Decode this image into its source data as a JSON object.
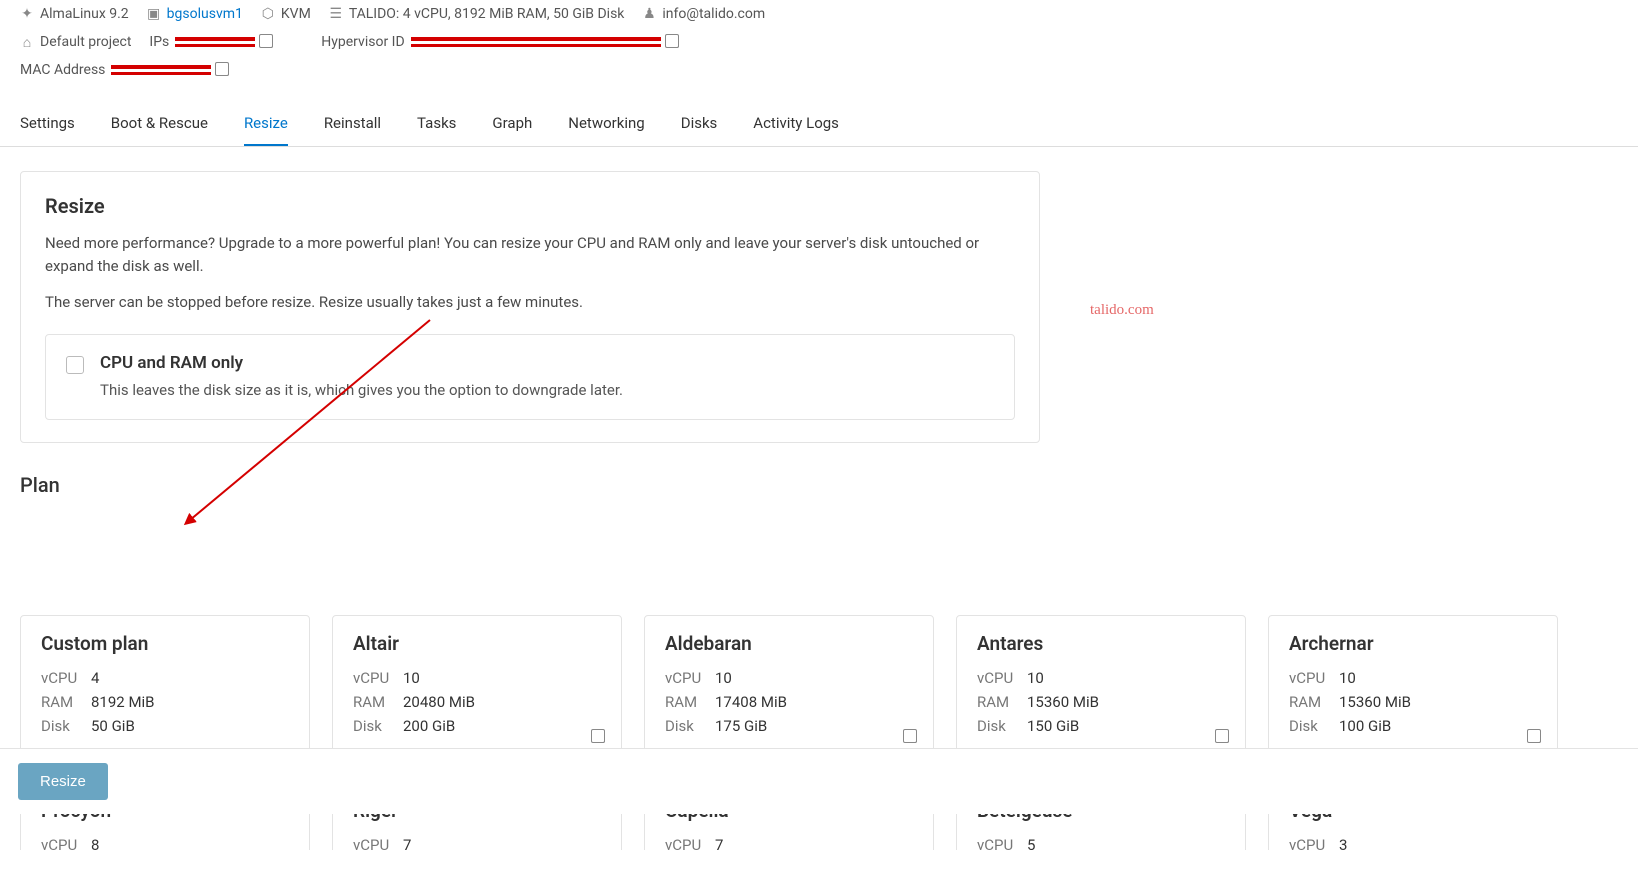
{
  "meta": {
    "os": "AlmaLinux 9.2",
    "hostname": "bgsolusvm1",
    "virt": "KVM",
    "specs": "TALIDO: 4 vCPU, 8192 MiB RAM, 50 GiB Disk",
    "email": "info@talido.com",
    "project": "Default project",
    "ips_label": "IPs",
    "hyp_label": "Hypervisor ID",
    "mac_label": "MAC Address"
  },
  "tabs": [
    "Settings",
    "Boot & Rescue",
    "Resize",
    "Reinstall",
    "Tasks",
    "Graph",
    "Networking",
    "Disks",
    "Activity Logs"
  ],
  "active_tab": "Resize",
  "resize": {
    "title": "Resize",
    "desc": "Need more performance? Upgrade to a more powerful plan! You can resize your CPU and RAM only and leave your server's disk untouched or expand the disk as well.",
    "warn": "The server can be stopped before resize. Resize usually takes just a few minutes.",
    "cpu_ram_only_title": "CPU and RAM only",
    "cpu_ram_only_desc": "This leaves the disk size as it is, which gives you the option to downgrade later."
  },
  "plan_title": "Plan",
  "spec_labels": {
    "vcpu": "vCPU",
    "ram": "RAM",
    "disk": "Disk"
  },
  "plans_row1": [
    {
      "name": "Custom plan",
      "vcpu": "4",
      "ram": "8192 MiB",
      "disk": "50 GiB",
      "copy": false
    },
    {
      "name": "Altair",
      "vcpu": "10",
      "ram": "20480 MiB",
      "disk": "200 GiB",
      "copy": true
    },
    {
      "name": "Aldebaran",
      "vcpu": "10",
      "ram": "17408 MiB",
      "disk": "175 GiB",
      "copy": true
    },
    {
      "name": "Antares",
      "vcpu": "10",
      "ram": "15360 MiB",
      "disk": "150 GiB",
      "copy": true
    },
    {
      "name": "Archernar",
      "vcpu": "10",
      "ram": "15360 MiB",
      "disk": "100 GiB",
      "copy": true
    }
  ],
  "plans_row2": [
    {
      "name": "Procyon",
      "vcpu": "8"
    },
    {
      "name": "Rigel",
      "vcpu": "7"
    },
    {
      "name": "Capella",
      "vcpu": "7"
    },
    {
      "name": "Betelgeuse",
      "vcpu": "5"
    },
    {
      "name": "Vega",
      "vcpu": "3"
    }
  ],
  "watermark": "talido.com",
  "footer_button": "Resize"
}
